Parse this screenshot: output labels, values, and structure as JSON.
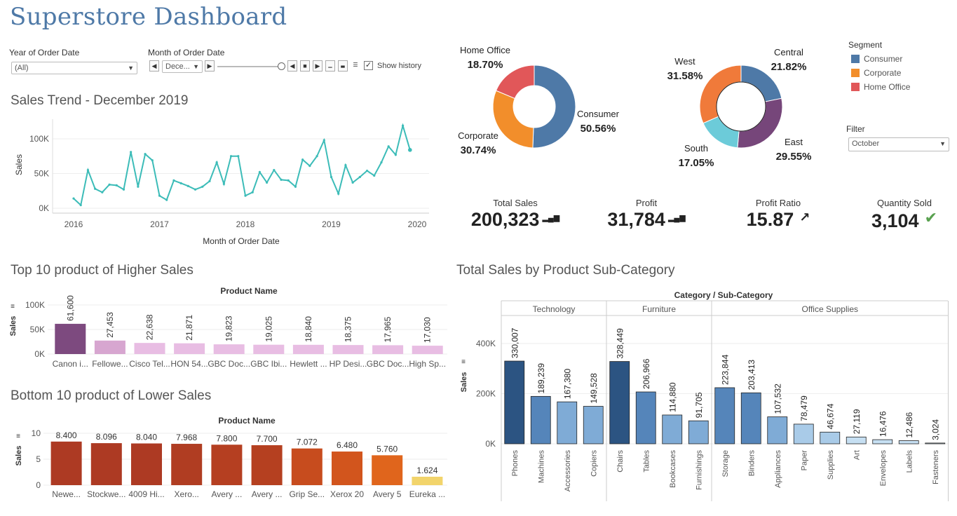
{
  "title": "Superstore Dashboard",
  "filters": {
    "year_label": "Year of Order Date",
    "year_value": "(All)",
    "month_label": "Month of Order Date",
    "month_value": "Dece...",
    "show_history_label": "Show history",
    "show_history_checked": true,
    "filter_label": "Filter",
    "filter_value": "October"
  },
  "segment_legend": {
    "title": "Segment",
    "items": [
      {
        "label": "Consumer",
        "color": "#4e79a7"
      },
      {
        "label": "Corporate",
        "color": "#f28e2b"
      },
      {
        "label": "Home Office",
        "color": "#e15759"
      }
    ]
  },
  "kpis": [
    {
      "label": "Total Sales",
      "value": "200,323",
      "icon": "bar-indicator-icon"
    },
    {
      "label": "Profit",
      "value": "31,784",
      "icon": "bar-indicator-icon"
    },
    {
      "label": "Profit Ratio",
      "value": "15.87",
      "icon": "arrow-up-right-icon"
    },
    {
      "label": "Quantity Sold",
      "value": "3,104",
      "icon": "check-icon"
    }
  ],
  "chart_data": [
    {
      "id": "sales_trend",
      "type": "line",
      "title": "Sales Trend - December 2019",
      "xlabel": "Month of Order Date",
      "ylabel": "Sales",
      "x_ticks": [
        "2016",
        "2017",
        "2018",
        "2019",
        "2020"
      ],
      "y_ticks": [
        "0K",
        "50K",
        "100K"
      ],
      "ylim": [
        0,
        120000
      ],
      "color": "#3cbcb8",
      "x": [
        "2016-01",
        "2016-02",
        "2016-03",
        "2016-04",
        "2016-05",
        "2016-06",
        "2016-07",
        "2016-08",
        "2016-09",
        "2016-10",
        "2016-11",
        "2016-12",
        "2017-01",
        "2017-02",
        "2017-03",
        "2017-04",
        "2017-05",
        "2017-06",
        "2017-07",
        "2017-08",
        "2017-09",
        "2017-10",
        "2017-11",
        "2017-12",
        "2018-01",
        "2018-02",
        "2018-03",
        "2018-04",
        "2018-05",
        "2018-06",
        "2018-07",
        "2018-08",
        "2018-09",
        "2018-10",
        "2018-11",
        "2018-12",
        "2019-01",
        "2019-02",
        "2019-03",
        "2019-04",
        "2019-05",
        "2019-06",
        "2019-07",
        "2019-08",
        "2019-09",
        "2019-10",
        "2019-11",
        "2019-12"
      ],
      "values": [
        14000,
        4500,
        55000,
        28000,
        23000,
        34000,
        33000,
        27000,
        81000,
        31000,
        78000,
        69000,
        18000,
        12000,
        40000,
        36000,
        32000,
        27000,
        31000,
        39000,
        66000,
        35000,
        75000,
        75000,
        18000,
        23000,
        52000,
        37000,
        55000,
        41000,
        40000,
        31000,
        70000,
        61000,
        75000,
        98000,
        45000,
        21000,
        62000,
        37000,
        45000,
        54000,
        47000,
        66000,
        89000,
        77000,
        119000,
        84000
      ]
    },
    {
      "id": "segment_pie",
      "type": "pie",
      "categories": [
        "Consumer",
        "Corporate",
        "Home Office"
      ],
      "values": [
        50.56,
        30.74,
        18.7
      ],
      "labels": [
        "50.56%",
        "30.74%",
        "18.70%"
      ],
      "colors": [
        "#4e79a7",
        "#f28e2b",
        "#e15759"
      ]
    },
    {
      "id": "region_pie",
      "type": "pie",
      "categories": [
        "Central",
        "East",
        "South",
        "West"
      ],
      "values": [
        21.82,
        29.55,
        17.05,
        31.58
      ],
      "labels": [
        "21.82%",
        "29.55%",
        "17.05%",
        "31.58%"
      ],
      "colors": [
        "#4e79a7",
        "#76467a",
        "#6ccbd9",
        "#f07a3a"
      ]
    },
    {
      "id": "top10",
      "type": "bar",
      "title": "Top 10 product of Higher Sales",
      "xlabel": "Product Name",
      "ylabel": "Sales",
      "y_ticks": [
        "0K",
        "50K",
        "100K"
      ],
      "ylim": [
        0,
        100000
      ],
      "categories": [
        "Canon i...",
        "Fellowe...",
        "Cisco Tel...",
        "HON 54...",
        "GBC Doc...",
        "GBC Ibi...",
        "Hewlett ...",
        "HP Desi...",
        "GBC Doc...",
        "High Sp..."
      ],
      "values": [
        61600,
        27453,
        22638,
        21871,
        19823,
        19025,
        18840,
        18375,
        17965,
        17030
      ],
      "labels": [
        "61,600",
        "27,453",
        "22,638",
        "21,871",
        "19,823",
        "19,025",
        "18,840",
        "18,375",
        "17,965",
        "17,030"
      ],
      "colors": [
        "#7d4a7f",
        "#d7a6d0",
        "#e8bde3",
        "#e8bde3",
        "#e8bde3",
        "#e8bde3",
        "#e8bde3",
        "#e8bde3",
        "#e8bde3",
        "#e8bde3"
      ]
    },
    {
      "id": "bottom10",
      "type": "bar",
      "title": "Bottom 10 product of Lower Sales",
      "xlabel": "Product Name",
      "ylabel": "Sales",
      "y_ticks": [
        "0",
        "5",
        "10"
      ],
      "ylim": [
        0,
        10
      ],
      "categories": [
        "Newe...",
        "Stockwe...",
        "4009 Hi...",
        "Xero...",
        "Avery ...",
        "Avery ...",
        "Grip Se...",
        "Xerox 20",
        "Avery 5",
        "Eureka ..."
      ],
      "values": [
        8.4,
        8.096,
        8.04,
        7.968,
        7.8,
        7.7,
        7.072,
        6.48,
        5.76,
        1.624
      ],
      "labels": [
        "8.400",
        "8.096",
        "8.040",
        "7.968",
        "7.800",
        "7.700",
        "7.072",
        "6.480",
        "5.760",
        "1.624"
      ],
      "colors": [
        "#ad3a23",
        "#ad3a23",
        "#ad3a23",
        "#b03d22",
        "#b53f21",
        "#b54020",
        "#c74c1e",
        "#d2551d",
        "#e0651c",
        "#f2d46b"
      ]
    },
    {
      "id": "subcategory",
      "type": "bar",
      "title": "Total Sales by Product Sub-Category",
      "header": "Category / Sub-Category",
      "ylabel": "Sales",
      "y_ticks": [
        "0K",
        "200K",
        "400K"
      ],
      "ylim": [
        0,
        450000
      ],
      "groups": [
        {
          "name": "Technology",
          "categories": [
            "Phones",
            "Machines",
            "Accessories",
            "Copiers"
          ],
          "values": [
            330007,
            189239,
            167380,
            149528
          ],
          "labels": [
            "330,007",
            "189,239",
            "167,380",
            "149,528"
          ]
        },
        {
          "name": "Furniture",
          "categories": [
            "Chairs",
            "Tables",
            "Bookcases",
            "Furnishings"
          ],
          "values": [
            328449,
            206966,
            114880,
            91705
          ],
          "labels": [
            "328,449",
            "206,966",
            "114,880",
            "91,705"
          ]
        },
        {
          "name": "Office Supplies",
          "categories": [
            "Storage",
            "Binders",
            "Appliances",
            "Paper",
            "Supplies",
            "Art",
            "Envelopes",
            "Labels",
            "Fasteners"
          ],
          "values": [
            223844,
            203413,
            107532,
            78479,
            46674,
            27119,
            16476,
            12486,
            3024
          ],
          "labels": [
            "223,844",
            "203,413",
            "107,532",
            "78,479",
            "46,674",
            "27,119",
            "16,476",
            "12,486",
            "3,024"
          ]
        }
      ]
    }
  ]
}
